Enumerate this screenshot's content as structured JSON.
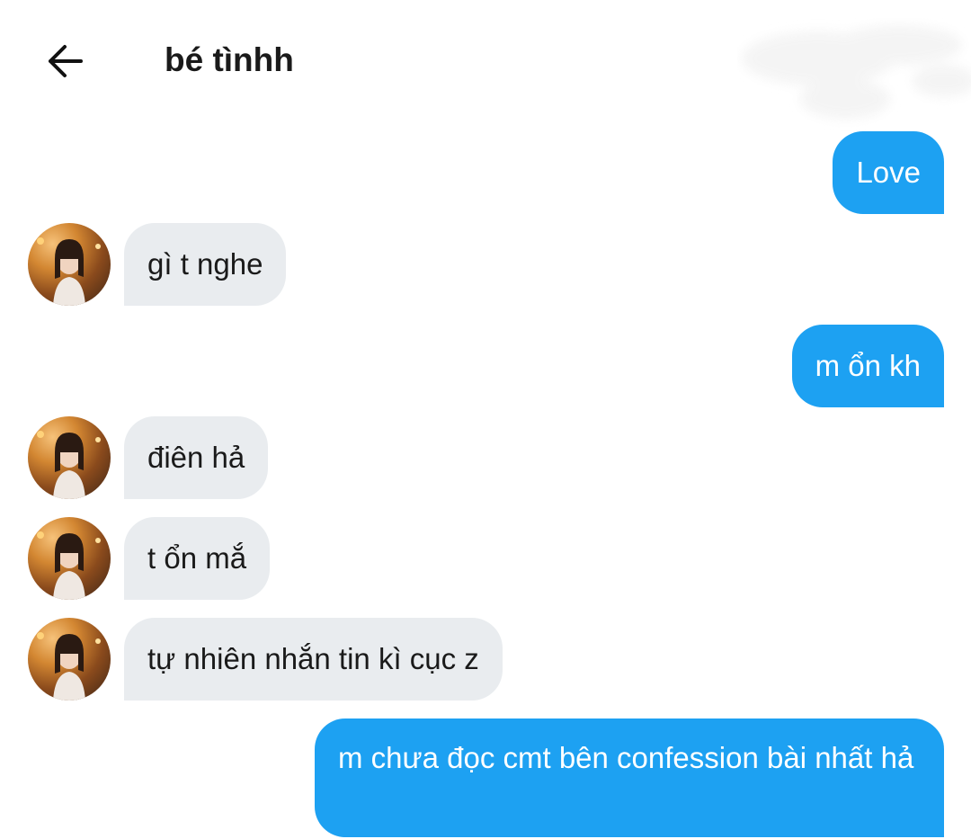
{
  "header": {
    "title": "bé tìnhh"
  },
  "messages": [
    {
      "direction": "out",
      "text": "Love"
    },
    {
      "direction": "in",
      "text": "gì t nghe"
    },
    {
      "direction": "out",
      "text": "m ổn kh"
    },
    {
      "direction": "in",
      "text": "điên hả"
    },
    {
      "direction": "in",
      "text": "t ổn mắ"
    },
    {
      "direction": "in",
      "text": "tự nhiên nhắn tin kì cục z"
    },
    {
      "direction": "out",
      "text": "m chưa đọc cmt bên confession bài nhất hả"
    }
  ],
  "colors": {
    "outgoing_bubble": "#1da1f2",
    "incoming_bubble": "#e9ecef",
    "text_dark": "#1a1a1a"
  },
  "icons": {
    "back": "arrow-left-icon",
    "avatar": "contact-avatar"
  }
}
